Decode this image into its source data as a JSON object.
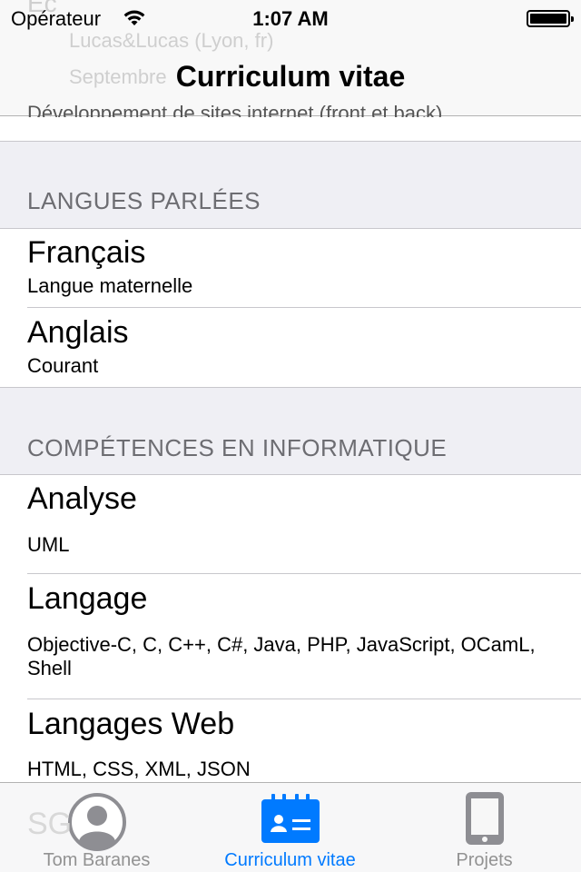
{
  "status_bar": {
    "carrier": "Opérateur",
    "time": "1:07 AM"
  },
  "nav": {
    "title": "Curriculum vitae"
  },
  "ghost_behind_bar": {
    "line1": "Ec",
    "line2": "Lucas&Lucas (Lyon, fr)",
    "line3": "Septembre",
    "line4": "Développement de sites internet (front et back)."
  },
  "sections": {
    "languages": {
      "header": "LANGUES PARLÉES",
      "items": [
        {
          "title": "Français",
          "subtitle": "Langue maternelle"
        },
        {
          "title": "Anglais",
          "subtitle": "Courant"
        }
      ]
    },
    "skills": {
      "header": "COMPÉTENCES EN INFORMATIQUE",
      "items": [
        {
          "title": "Analyse",
          "subtitle": "UML"
        },
        {
          "title": "Langage",
          "subtitle": "Objective-C, C, C++, C#, Java, PHP, JavaScript, OCamL, Shell"
        },
        {
          "title": "Langages Web",
          "subtitle": "HTML, CSS, XML, JSON"
        }
      ]
    }
  },
  "ghost_under_tabbar": "SG",
  "tabs": [
    {
      "label": "Tom Baranes",
      "icon": "person-icon",
      "active": false
    },
    {
      "label": "Curriculum vitae",
      "icon": "id-card-icon",
      "active": true
    },
    {
      "label": "Projets",
      "icon": "tablet-icon",
      "active": false
    }
  ],
  "colors": {
    "accent": "#007aff",
    "inactive": "#929292",
    "section_bg": "#efeff4",
    "header_text": "#6d6d72"
  }
}
